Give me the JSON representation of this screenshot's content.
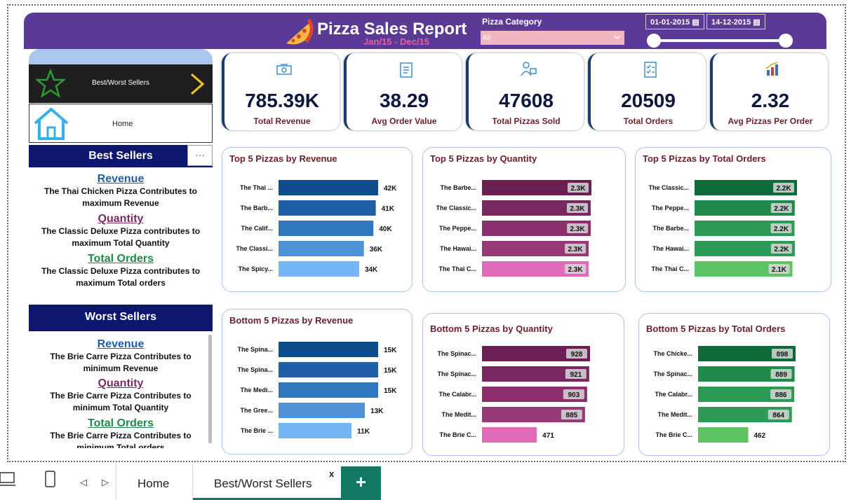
{
  "header": {
    "title": "Pizza Sales Report",
    "subtitle": "Jan/15 - Dec/15",
    "category_label": "Pizza Category",
    "category_value": "All",
    "start_date": "01-01-2015",
    "end_date": "14-12-2015",
    "brand_color": "#5b3a96"
  },
  "nav": {
    "best_worst_label": "Best/Worst Sellers",
    "home_label": "Home"
  },
  "best": {
    "title": "Best Sellers",
    "more": "···",
    "items": [
      {
        "title": "Revenue",
        "desc": "The Thai Chicken Pizza Contributes to maximum Revenue",
        "color": "#1f5fa6"
      },
      {
        "title": "Quantity",
        "desc": "The Classic Deluxe Pizza contributes to maximum Total Quantity",
        "color": "#7b2a68"
      },
      {
        "title": "Total Orders",
        "desc": "The Classic Deluxe Pizza contributes to maximum Total orders",
        "color": "#1f8a4a"
      }
    ]
  },
  "worst": {
    "title": "Worst Sellers",
    "items": [
      {
        "title": "Revenue",
        "desc": "The Brie Carre Pizza Contributes to minimum Revenue",
        "color": "#1f5fa6"
      },
      {
        "title": "Quantity",
        "desc": "The Brie Carre Pizza Contributes to minimum Total Quantity",
        "color": "#7b2a68"
      },
      {
        "title": "Total Orders",
        "desc": "The Brie Carre Pizza Contributes to minimum Total orders",
        "color": "#1f8a4a"
      }
    ]
  },
  "kpis": [
    {
      "value": "785.39K",
      "label": "Total Revenue",
      "icon": "money-icon"
    },
    {
      "value": "38.29",
      "label": "Avg Order Value",
      "icon": "clipboard-icon"
    },
    {
      "value": "47608",
      "label": "Total Pizzas Sold",
      "icon": "delivery-icon"
    },
    {
      "value": "20509",
      "label": "Total Orders",
      "icon": "checklist-icon"
    },
    {
      "value": "2.32",
      "label": "Avg Pizzas Per Order",
      "icon": "bar-chart-icon"
    }
  ],
  "chart_data": [
    {
      "type": "bar",
      "title": "Top 5 Pizzas by Revenue",
      "categories": [
        "The Thai ...",
        "The Barb...",
        "The Calif...",
        "The Classi...",
        "The Spicy..."
      ],
      "values": [
        42000,
        41000,
        40000,
        36000,
        34000
      ],
      "labels": [
        "42K",
        "41K",
        "40K",
        "36K",
        "34K"
      ],
      "colors": [
        "#0f4c8c",
        "#1e5fa8",
        "#2e78c0",
        "#4f93d6",
        "#74b6f5"
      ],
      "label_style": "outside"
    },
    {
      "type": "bar",
      "title": "Top 5 Pizzas by Quantity",
      "categories": [
        "The Barbe...",
        "The Classic...",
        "The Peppe...",
        "The Hawai...",
        "The Thai C..."
      ],
      "values": [
        2432,
        2416,
        2418,
        2370,
        2371
      ],
      "labels": [
        "2.3K",
        "2.3K",
        "2.3K",
        "2.3K",
        "2.3K"
      ],
      "colors": [
        "#6b1f52",
        "#772860",
        "#8a306c",
        "#953a76",
        "#e06bbb"
      ],
      "label_style": "inside"
    },
    {
      "type": "bar",
      "title": "Top 5 Pizzas by Total Orders",
      "categories": [
        "The Classic...",
        "The Peppe...",
        "The Barbe...",
        "The Hawai...",
        "The Thai C..."
      ],
      "values": [
        2329,
        2278,
        2273,
        2280,
        2225
      ],
      "labels": [
        "2.2K",
        "2.2K",
        "2.2K",
        "2.2K",
        "2.1K"
      ],
      "colors": [
        "#0f6a3a",
        "#1f8a4a",
        "#2a9a55",
        "#2d9a57",
        "#5cc462"
      ],
      "label_style": "inside"
    },
    {
      "type": "bar",
      "title": "Bottom 5 Pizzas by Revenue",
      "categories": [
        "The Spina...",
        "The Spina...",
        "The Medi...",
        "The Gree...",
        "The Brie ..."
      ],
      "values": [
        15000,
        15000,
        15000,
        13000,
        11000
      ],
      "labels": [
        "15K",
        "15K",
        "15K",
        "13K",
        "11K"
      ],
      "colors": [
        "#0f4c8c",
        "#1e5fa8",
        "#2e78c0",
        "#4f93d6",
        "#74b6f5"
      ],
      "label_style": "outside"
    },
    {
      "type": "bar",
      "title": "Bottom 5 Pizzas by Quantity",
      "categories": [
        "The Spinac...",
        "The Spinac...",
        "The Calabr...",
        "The Medit...",
        "The Brie C..."
      ],
      "values": [
        928,
        921,
        903,
        885,
        471
      ],
      "labels": [
        "928",
        "921",
        "903",
        "885",
        "471"
      ],
      "colors": [
        "#6b1f52",
        "#772860",
        "#8a306c",
        "#953a76",
        "#e06bbb"
      ],
      "label_style": "mixed"
    },
    {
      "type": "bar",
      "title": "Bottom 5 Pizzas by Total Orders",
      "categories": [
        "The Chicke...",
        "The Spinac...",
        "The Calabr...",
        "The Medit...",
        "The Brie C..."
      ],
      "values": [
        898,
        889,
        886,
        864,
        462
      ],
      "labels": [
        "898",
        "889",
        "886",
        "864",
        "462"
      ],
      "colors": [
        "#0f6a3a",
        "#1f8a4a",
        "#2a9a55",
        "#2d9a57",
        "#5cc462"
      ],
      "label_style": "mixed"
    }
  ],
  "tabs": {
    "home": "Home",
    "best_worst": "Best/Worst Sellers",
    "close": "x",
    "add": "+"
  }
}
